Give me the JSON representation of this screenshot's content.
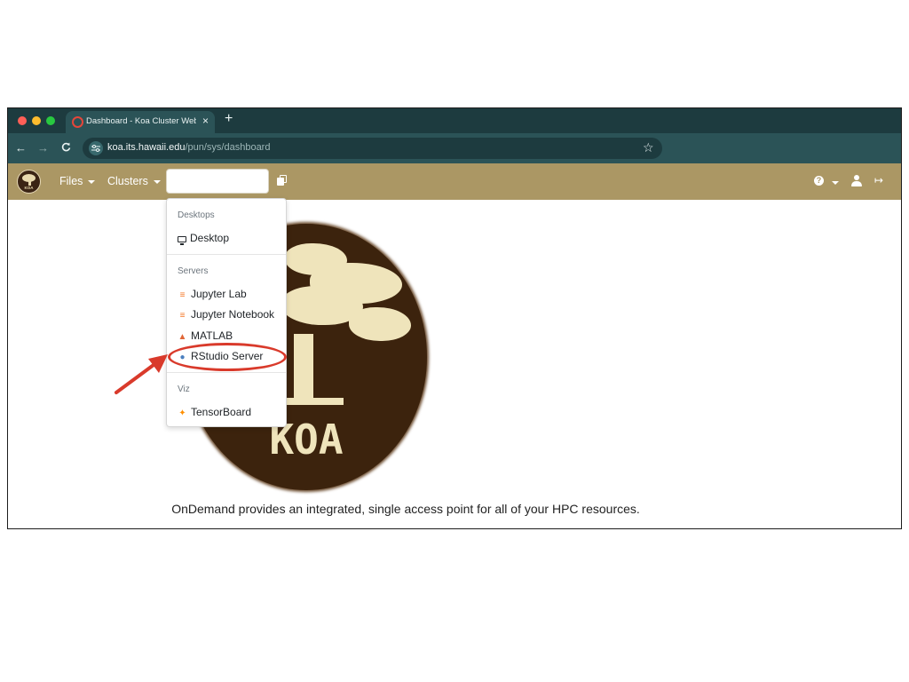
{
  "browser": {
    "tab": {
      "title": "Dashboard - Koa Cluster Web",
      "close": "×"
    },
    "new_tab": "+",
    "nav": {
      "back": "←",
      "forward": "→",
      "reload": "C"
    },
    "site_info_icon": "tune",
    "url_host": "koa.its.hawaii.edu",
    "url_path": "/pun/sys/dashboard",
    "bookmark_star": "☆"
  },
  "navbar": {
    "logo_text": "KOA",
    "files": "Files",
    "clusters": "Clusters",
    "search_value": "",
    "help": "?",
    "logout": "↦"
  },
  "dropdown": {
    "sections": [
      {
        "header": "Desktops",
        "items": [
          {
            "label": "Desktop",
            "icon": "monitor-icon"
          }
        ]
      },
      {
        "header": "Servers",
        "items": [
          {
            "label": "Jupyter Lab",
            "icon": "jupyter-icon",
            "color": "#f37726"
          },
          {
            "label": "Jupyter Notebook",
            "icon": "jupyter-icon",
            "color": "#f37726"
          },
          {
            "label": "MATLAB",
            "icon": "matlab-icon",
            "color": "#e16737"
          },
          {
            "label": "RStudio Server",
            "icon": "rstudio-icon",
            "color": "#4a7fbf"
          }
        ]
      },
      {
        "header": "Viz",
        "items": [
          {
            "label": "TensorBoard",
            "icon": "tensorboard-icon",
            "color": "#ff8f00"
          }
        ]
      }
    ]
  },
  "main": {
    "logo_word": "KOA",
    "tagline": "OnDemand provides an integrated, single access point for all of your HPC resources."
  },
  "colors": {
    "navbar": "#ab9764",
    "tab_strip": "#1d3b3f",
    "address_row": "#2b5357",
    "annotation": "#d93a2b",
    "logo_bg": "#3c230d",
    "logo_fg": "#efe4bb"
  }
}
